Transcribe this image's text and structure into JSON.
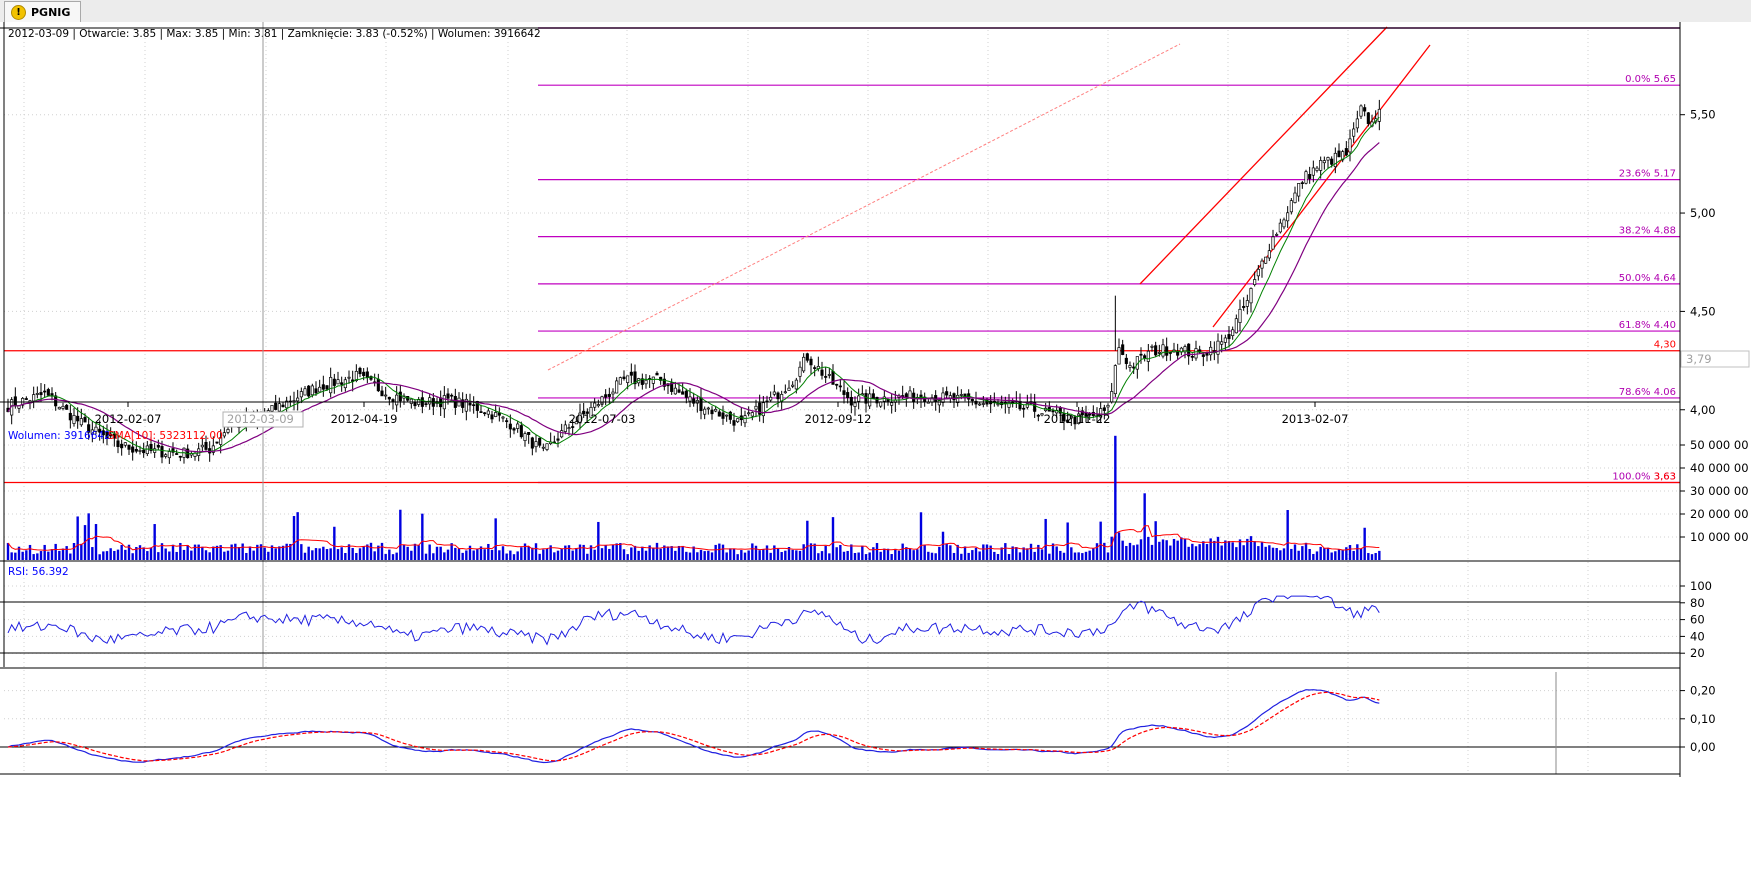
{
  "tab": {
    "label": "PGNIG",
    "icon": "warning-icon"
  },
  "header": {
    "info": "2012-03-09 | Otwarcie: 3.85 | Max: 3.85 | Min: 3.81 | Zamknięcie: 3.83 (-0.52%)  | Wolumen: 3916642"
  },
  "price_axis": {
    "ticks": [
      "5,50",
      "5,00",
      "4,50",
      "4,00"
    ],
    "current": "3,79"
  },
  "fibonacci": [
    {
      "label": "0.0% 5.65",
      "value": 5.65
    },
    {
      "label": "23.6% 5.17",
      "value": 5.17
    },
    {
      "label": "38.2% 4.88",
      "value": 4.88
    },
    {
      "label": "50.0% 4.64",
      "value": 4.64
    },
    {
      "label": "61.8% 4.40",
      "value": 4.4
    },
    {
      "label": "78.6% 4.06",
      "value": 4.06
    },
    {
      "label": "100.0% 3.63",
      "value": 3.63
    }
  ],
  "hlines": [
    {
      "label": "4,30",
      "value": 4.3
    },
    {
      "label": "3,63",
      "value": 3.63
    }
  ],
  "date_axis": {
    "labels": [
      "2012-02-07",
      "2012-04-19",
      "2012-07-03",
      "2012-09-12",
      "2012-11-22",
      "2013-02-07"
    ],
    "cursor_label": "2012-03-09"
  },
  "volume_panel": {
    "label_volume": "Wolumen: 3916642",
    "label_sma": "SMA[10]: 5323112.00",
    "ticks": [
      "50 000 00",
      "40 000 00",
      "30 000 00",
      "20 000 00",
      "10 000 00"
    ]
  },
  "rsi_panel": {
    "label": "RSI: 56.392",
    "ticks": [
      "100",
      "80",
      "60",
      "40",
      "20"
    ]
  },
  "macd_panel": {
    "ticks": [
      "0,20",
      "0,10",
      "0,00"
    ]
  },
  "colors": {
    "up": "#ffffff",
    "down": "#000000",
    "sma_short": "#008000",
    "sma_long": "#800080",
    "fib": "#c000c0",
    "hline": "#ff0000",
    "volume": "#0000e0",
    "volume_sma": "#ff0000",
    "rsi": "#2020e0",
    "macd": "#2020e0",
    "signal": "#ff0000",
    "fib_text": "#b000b0"
  },
  "chart_data": {
    "type": "candlestick",
    "instrument": "PGNIG",
    "anchor_closes": [
      [
        0,
        4.02
      ],
      [
        10,
        4.08
      ],
      [
        20,
        3.93
      ],
      [
        30,
        3.82
      ],
      [
        38,
        3.79
      ],
      [
        48,
        3.78
      ],
      [
        55,
        3.8
      ],
      [
        60,
        3.91
      ],
      [
        68,
        3.95
      ],
      [
        75,
        4.03
      ],
      [
        85,
        4.12
      ],
      [
        95,
        4.17
      ],
      [
        104,
        4.08
      ],
      [
        112,
        4.03
      ],
      [
        120,
        4.05
      ],
      [
        130,
        4.0
      ],
      [
        138,
        3.92
      ],
      [
        146,
        3.78
      ],
      [
        152,
        3.9
      ],
      [
        160,
        4.02
      ],
      [
        168,
        4.15
      ],
      [
        178,
        4.15
      ],
      [
        186,
        4.05
      ],
      [
        194,
        3.98
      ],
      [
        200,
        3.93
      ],
      [
        208,
        4.05
      ],
      [
        214,
        4.15
      ],
      [
        218,
        4.27
      ],
      [
        224,
        4.15
      ],
      [
        230,
        4.05
      ],
      [
        240,
        4.06
      ],
      [
        250,
        4.07
      ],
      [
        260,
        4.05
      ],
      [
        270,
        4.02
      ],
      [
        280,
        4.0
      ],
      [
        290,
        3.95
      ],
      [
        295,
        3.96
      ],
      [
        300,
        4.0
      ],
      [
        303,
        4.32
      ],
      [
        306,
        4.22
      ],
      [
        312,
        4.3
      ],
      [
        318,
        4.31
      ],
      [
        325,
        4.28
      ],
      [
        332,
        4.35
      ],
      [
        338,
        4.55
      ],
      [
        343,
        4.8
      ],
      [
        348,
        4.98
      ],
      [
        353,
        5.17
      ],
      [
        358,
        5.25
      ],
      [
        365,
        5.3
      ],
      [
        369,
        5.52
      ],
      [
        372,
        5.45
      ],
      [
        374,
        5.55
      ]
    ],
    "volume_sma_last": 5323112.0,
    "rsi_last": 56.392
  }
}
